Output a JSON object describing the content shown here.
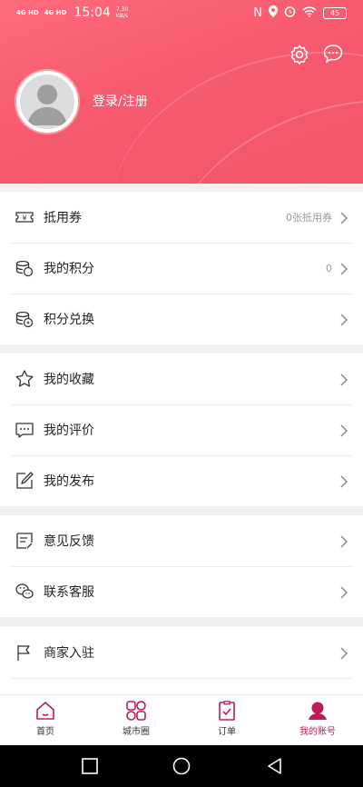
{
  "status_bar": {
    "signal1": "4G HD",
    "signal2": "4G HD",
    "time": "15:04",
    "speed_value": "7.30",
    "speed_unit": "KB/s",
    "battery": "45"
  },
  "header": {
    "login_label": "登录/注册",
    "settings_icon": "gear-icon",
    "message_icon": "chat-bubble-icon"
  },
  "groups": [
    {
      "items": [
        {
          "label": "抵用券",
          "value": "0张抵用券",
          "icon": "ticket-icon"
        },
        {
          "label": "我的积分",
          "value": "0",
          "icon": "coins-icon"
        },
        {
          "label": "积分兑换",
          "value": "",
          "icon": "coin-exchange-icon"
        }
      ]
    },
    {
      "items": [
        {
          "label": "我的收藏",
          "value": "",
          "icon": "star-icon"
        },
        {
          "label": "我的评价",
          "value": "",
          "icon": "comment-icon"
        },
        {
          "label": "我的发布",
          "value": "",
          "icon": "edit-icon"
        }
      ]
    },
    {
      "items": [
        {
          "label": "意见反馈",
          "value": "",
          "icon": "feedback-icon"
        },
        {
          "label": "联系客服",
          "value": "",
          "icon": "wechat-icon"
        }
      ]
    },
    {
      "items": [
        {
          "label": "商家入驻",
          "value": "",
          "icon": "flag-icon"
        }
      ]
    }
  ],
  "tabbar": {
    "tabs": [
      {
        "label": "首页",
        "icon": "home-icon"
      },
      {
        "label": "城市圈",
        "icon": "grid-icon"
      },
      {
        "label": "订单",
        "icon": "clipboard-icon"
      },
      {
        "label": "我的账号",
        "icon": "user-icon",
        "active": true
      }
    ],
    "active_color": "#c2185b"
  },
  "colors": {
    "header_start": "#ff6b7d",
    "header_end": "#f2566a",
    "accent": "#c2185b"
  }
}
